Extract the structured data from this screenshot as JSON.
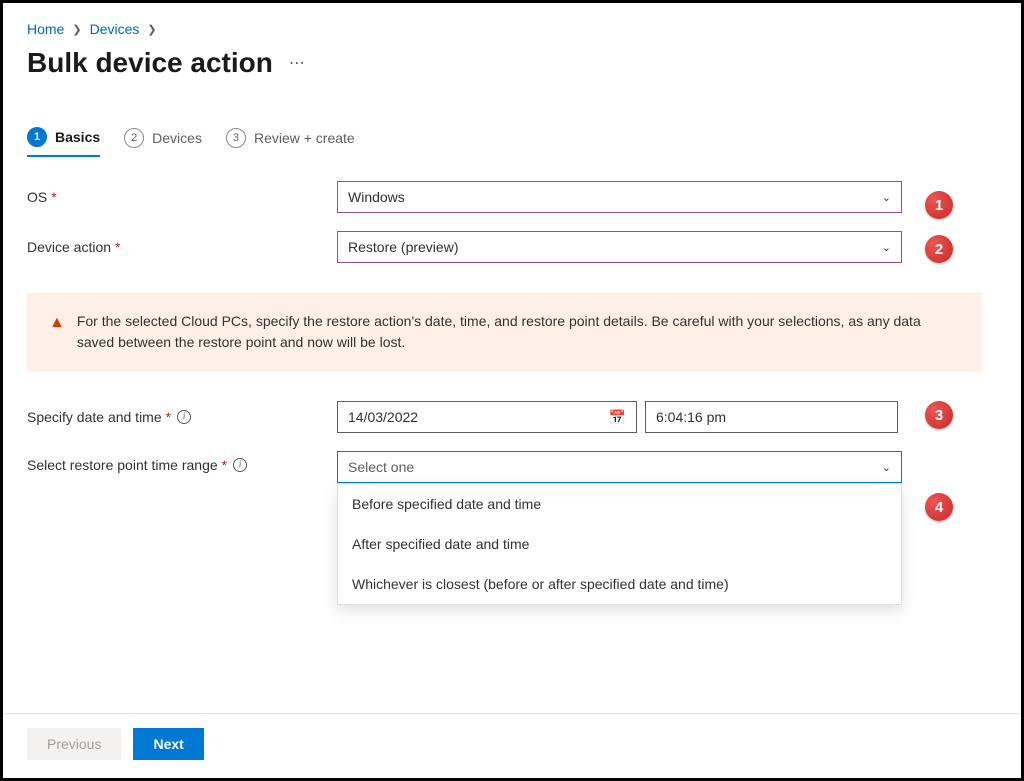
{
  "breadcrumb": {
    "home": "Home",
    "devices": "Devices"
  },
  "pageTitle": "Bulk device action",
  "tabs": {
    "basics": {
      "num": "1",
      "label": "Basics"
    },
    "devices": {
      "num": "2",
      "label": "Devices"
    },
    "review": {
      "num": "3",
      "label": "Review + create"
    }
  },
  "form": {
    "os_label": "OS",
    "os_value": "Windows",
    "action_label": "Device action",
    "action_value": "Restore (preview)",
    "datetime_label": "Specify date and time",
    "date_value": "14/03/2022",
    "time_value": "6:04:16 pm",
    "range_label": "Select restore point time range",
    "range_placeholder": "Select one",
    "range_options": [
      "Before specified date and time",
      "After specified date and time",
      "Whichever is closest (before or after specified date and time)"
    ]
  },
  "warning": "For the selected Cloud PCs, specify the restore action's date, time, and restore point details. Be careful with your selections, as any data saved between the restore point and now will be lost.",
  "footer": {
    "previous": "Previous",
    "next": "Next"
  },
  "callouts": [
    "1",
    "2",
    "3",
    "4"
  ]
}
